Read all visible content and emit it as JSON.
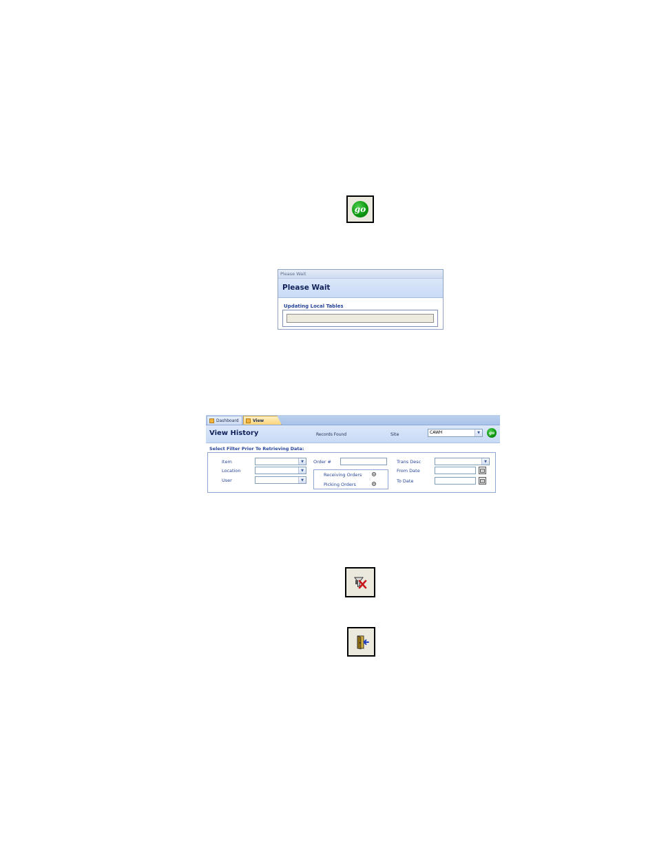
{
  "go_button": {
    "icon": "go-icon",
    "glyph": "go"
  },
  "please_wait": {
    "window_title": "Please Wait",
    "header": "Please Wait",
    "status_label": "Updating Local Tables",
    "progress": 0
  },
  "view_history": {
    "tabs": [
      {
        "label": "Dashboard",
        "active": false
      },
      {
        "label": "View History",
        "active": true
      }
    ],
    "title": "View History",
    "records_found_label": "Records Found",
    "site_label": "Site",
    "site_value": "CAWH",
    "go_glyph": "go",
    "filter_prompt": "Select Filter Prior To Retrieving Data:",
    "fields": {
      "item": "Item",
      "location": "Location",
      "user": "User",
      "order_no": "Order #",
      "trans_desc": "Trans Desc",
      "from_date": "From Date",
      "to_date": "To Date"
    },
    "order_types": [
      {
        "label": "Receiving Orders"
      },
      {
        "label": "Picking Orders"
      }
    ]
  },
  "clear_filter_button": {
    "icon": "clear-filter-icon"
  },
  "exit_button": {
    "icon": "exit-door-icon"
  },
  "colors": {
    "header_blue": "#c9dbf6",
    "label_blue": "#26459a",
    "go_green": "#0f9a12",
    "active_tab": "#fbd47a"
  }
}
